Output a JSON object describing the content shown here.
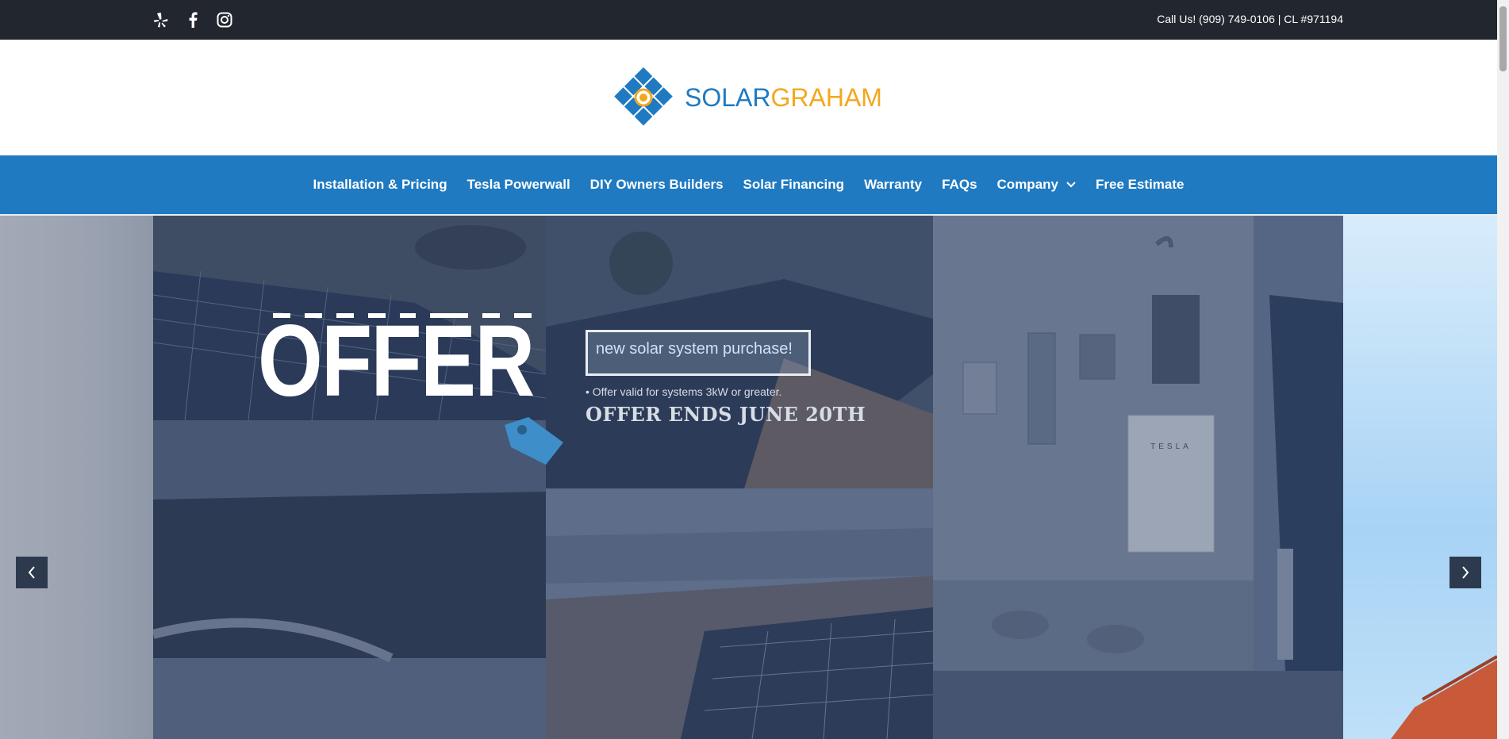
{
  "topbar": {
    "phone_text": "Call Us! (909) 749-0106 | CL #971194",
    "social_icons": [
      "yelp-icon",
      "facebook-icon",
      "instagram-icon"
    ]
  },
  "logo": {
    "word_part1": "SOLAR",
    "word_part2": "GRAHAM",
    "colors": {
      "blue": "#1f7ac1",
      "orange": "#f2a81d"
    }
  },
  "nav": {
    "items": [
      {
        "label": "Installation & Pricing"
      },
      {
        "label": "Tesla Powerwall"
      },
      {
        "label": "DIY Owners Builders"
      },
      {
        "label": "Solar Financing"
      },
      {
        "label": "Warranty"
      },
      {
        "label": "FAQs"
      },
      {
        "label": "Company"
      },
      {
        "label": "Free Estimate"
      }
    ]
  },
  "hero": {
    "offer_word": "OFFER",
    "promo_text": "new solar system purchase!",
    "fine_print": "• Offer valid for systems 3kW or greater.",
    "offer_ends": "OFFER ENDS JUNE 20TH",
    "equipment_label": "TESLA"
  },
  "colors": {
    "topbar": "#22262e",
    "nav": "#1f7ac1"
  }
}
